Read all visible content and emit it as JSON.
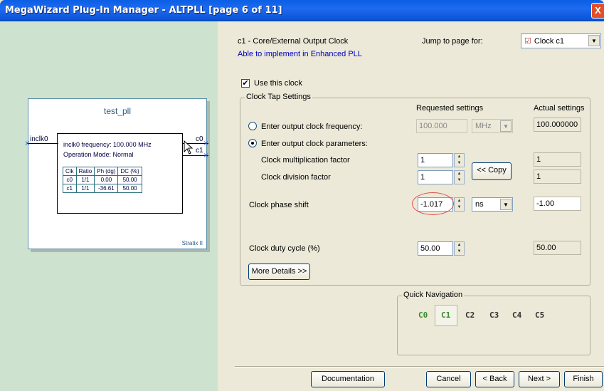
{
  "window": {
    "title": "MegaWizard Plug-In Manager - ALTPLL [page 6 of 11]",
    "close_glyph": "X"
  },
  "block": {
    "name": "test_pll",
    "input_pin": "inclk0",
    "output_pins": [
      "c0",
      "c1"
    ],
    "info_line1": "inclk0 frequency: 100.000 MHz",
    "info_line2": "Operation Mode: Normal",
    "device": "Stratix II",
    "table_headers": [
      "Clk",
      "Ratio",
      "Ph (dg)",
      "DC (%)"
    ],
    "table_rows": [
      [
        "c0",
        "1/1",
        "0.00",
        "50.00"
      ],
      [
        "c1",
        "1/1",
        "-36.61",
        "50.00"
      ]
    ]
  },
  "header": {
    "clock_title": "c1 - Core/External Output Clock",
    "pll_note": "Able to implement in Enhanced PLL",
    "jump_label": "Jump to page for:",
    "jump_value": "Clock c1"
  },
  "use_clock": {
    "label": "Use this clock",
    "checked": true
  },
  "tap_settings": {
    "group_title": "Clock Tap Settings",
    "requested_header": "Requested settings",
    "actual_header": "Actual settings",
    "freq_radio_label": "Enter output clock frequency:",
    "freq_value": "100.000",
    "freq_unit": "MHz",
    "freq_actual": "100.000000",
    "params_radio_label": "Enter output clock parameters:",
    "mult_label": "Clock multiplication factor",
    "mult_value": "1",
    "mult_actual": "1",
    "div_label": "Clock division factor",
    "div_value": "1",
    "div_actual": "1",
    "copy_button": "<< Copy",
    "phase_label": "Clock phase shift",
    "phase_value": "-1.017",
    "phase_unit": "ns",
    "phase_actual": "-1.00",
    "duty_label": "Clock duty cycle (%)",
    "duty_value": "50.00",
    "duty_actual": "50.00",
    "more_details_button": "More Details >>"
  },
  "quick_nav": {
    "title": "Quick Navigation",
    "items": [
      "C0",
      "C1",
      "C2",
      "C3",
      "C4",
      "C5"
    ],
    "active": "C1"
  },
  "footer": {
    "documentation": "Documentation",
    "cancel": "Cancel",
    "back": "< Back",
    "next": "Next >",
    "finish": "Finish"
  }
}
